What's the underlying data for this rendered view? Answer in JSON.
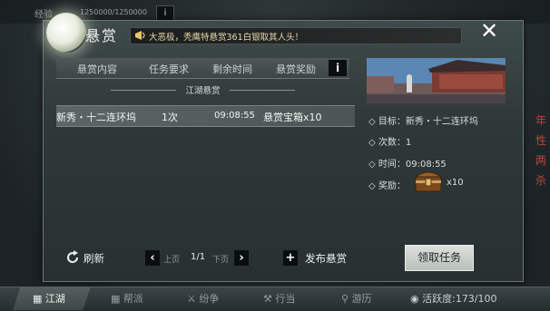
{
  "top_bar": {
    "exp_label": "经验",
    "exp_value": "1250000/1250000",
    "info_icon": "i"
  },
  "panel": {
    "title": "悬赏",
    "notice": "大恶极，秃鹰特悬赏361白银取其人头！",
    "close_icon": "✕"
  },
  "table": {
    "headers": [
      "悬赏内容",
      "任务要求",
      "剩余时间",
      "悬赏奖励"
    ],
    "info_icon": "i",
    "section_title": "江湖悬赏",
    "rows": [
      {
        "content": "新秀・十二连环坞",
        "requirement": "1次",
        "time": "09:08:55",
        "reward": "悬赏宝箱x10"
      }
    ]
  },
  "detail": {
    "target_label": "目标：",
    "target_value": "新秀・十二连环坞",
    "count_label": "次数：",
    "count_value": "1",
    "time_label": "时间：",
    "time_value": "09:08:55",
    "reward_label": "奖励：",
    "reward_qty": "x10"
  },
  "controls": {
    "refresh_label": "刷新",
    "prev_label": "上页",
    "page": "1/1",
    "next_label": "下页",
    "publish_label": "发布悬赏",
    "accept_label": "领取任务"
  },
  "nav": {
    "tabs": [
      "江湖",
      "帮派",
      "纷争",
      "行当",
      "游历"
    ],
    "activity": "活跃度:173/100"
  },
  "side_text": [
    "年",
    "性",
    "两",
    "杀"
  ]
}
